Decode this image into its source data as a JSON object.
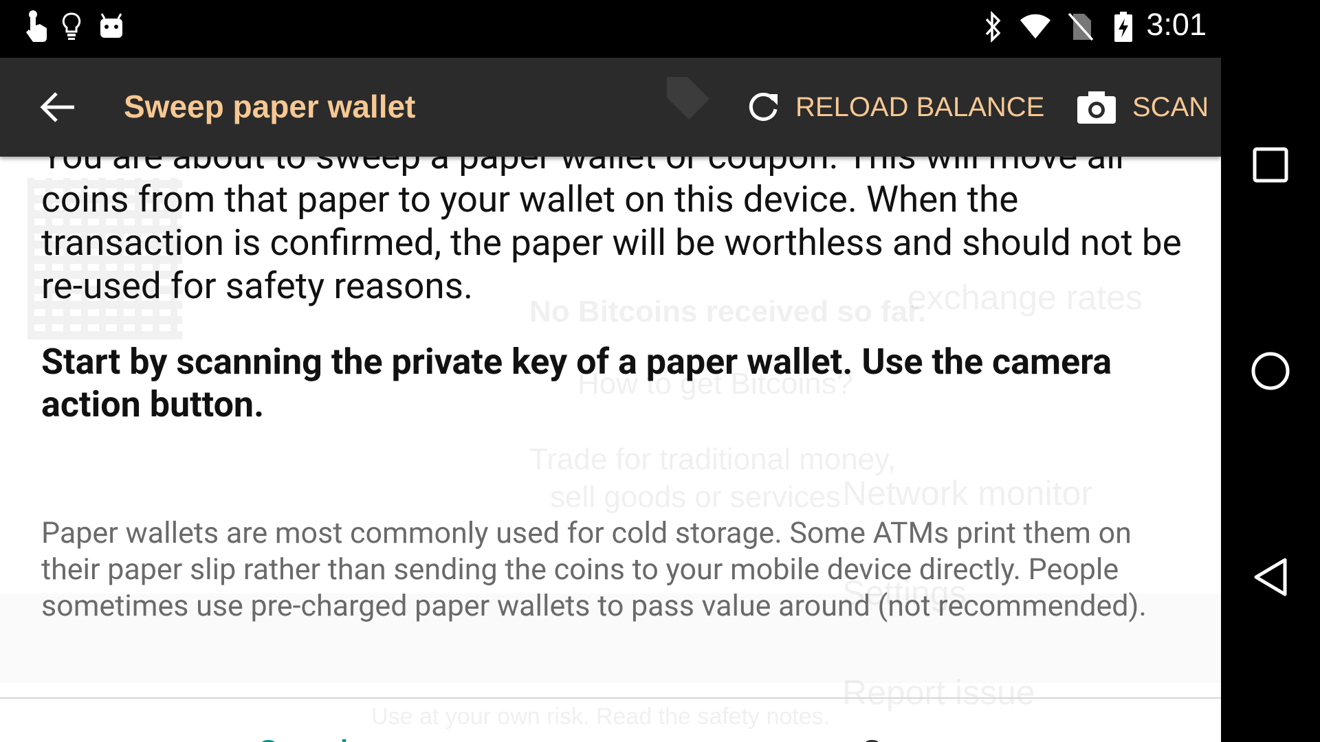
{
  "status_bar": {
    "time": "3:01",
    "left_icons": [
      "touch-icon",
      "lightbulb-icon",
      "android-icon"
    ],
    "right_icons": [
      "bluetooth-icon",
      "wifi-icon",
      "no-sim-icon",
      "battery-charging-icon"
    ]
  },
  "toolbar": {
    "title": "Sweep paper wallet",
    "reload_label": "RELOAD BALANCE",
    "scan_label": "SCAN",
    "accent_color": "#f7c893",
    "background_color": "#2b2b2b"
  },
  "dialog": {
    "intro": "You are about to sweep a paper wallet or coupon. This will move all coins from that paper to your wallet on this device. When the transaction is confirmed, the paper will be worthless and should not be re-used for safety reasons.",
    "instruction": "Start by scanning the private key of a paper wallet. Use the camera action button.",
    "note": "Paper wallets are most commonly used for cold storage. Some ATMs print them on their paper slip rather than sending the coins to your mobile device directly. People sometimes use pre-charged paper wallets to pass value around (not recommended).",
    "cancel_label": "Cancel",
    "sweep_label": "Sweep",
    "button_color": "#009688"
  },
  "background_screen": {
    "lines": [
      "No Bitcoins received so far.",
      "How to get Bitcoins?",
      "Trade for traditional money,",
      "sell goods or services",
      "Network monitor",
      "Settings",
      "Report issue",
      "Use at your own risk. Read the safety notes.",
      "exchange rates"
    ]
  },
  "nav_bar": {
    "icons": [
      "recents-icon",
      "home-icon",
      "back-icon"
    ]
  }
}
